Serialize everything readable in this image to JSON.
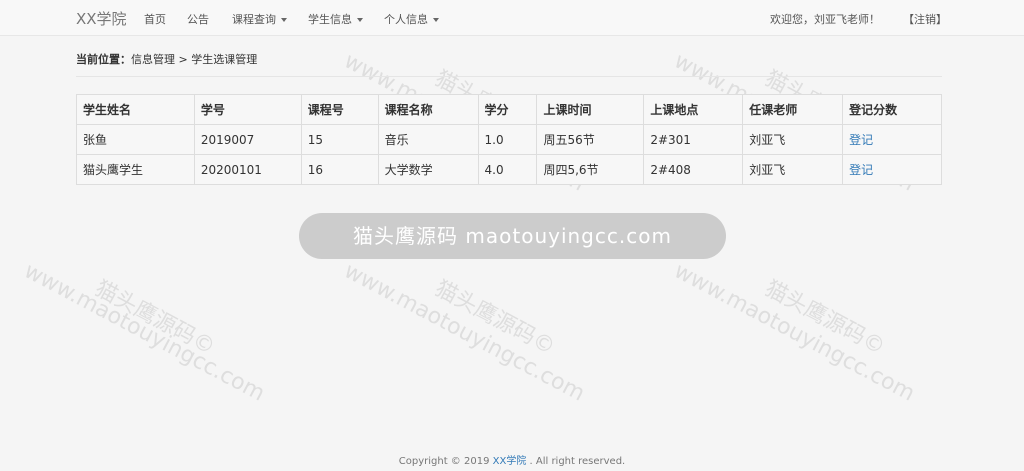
{
  "navbar": {
    "brand": "XX学院",
    "items": [
      {
        "label": "首页",
        "has_dropdown": false
      },
      {
        "label": "公告",
        "has_dropdown": false
      },
      {
        "label": "课程查询",
        "has_dropdown": true
      },
      {
        "label": "学生信息",
        "has_dropdown": true
      },
      {
        "label": "个人信息",
        "has_dropdown": true
      }
    ],
    "welcome": "欢迎您，刘亚飞老师！",
    "logout": "【注销】"
  },
  "breadcrumb": {
    "label": "当前位置：",
    "path": "信息管理 > 学生选课管理"
  },
  "table": {
    "headers": [
      "学生姓名",
      "学号",
      "课程号",
      "课程名称",
      "学分",
      "上课时间",
      "上课地点",
      "任课老师",
      "登记分数"
    ],
    "rows": [
      [
        "张鱼",
        "2019007",
        "15",
        "音乐",
        "1.0",
        "周五56节",
        "2#301",
        "刘亚飞",
        "登记"
      ],
      [
        "猫头鹰学生",
        "20200101",
        "16",
        "大学数学",
        "4.0",
        "周四5,6节",
        "2#408",
        "刘亚飞",
        "登记"
      ]
    ]
  },
  "toast": "猫头鹰源码 maotouyingcc.com",
  "watermark": {
    "line1": "猫头鹰源码©",
    "line2": "www.maotouyingcc.com"
  },
  "footer": {
    "prefix": "Copyright © 2019 ",
    "brand": "XX学院",
    "suffix": " . All right reserved."
  },
  "colors": {
    "link": "#337ab7",
    "navbar_bg": "#f8f8f8",
    "page_bg": "#f5f5f5"
  }
}
